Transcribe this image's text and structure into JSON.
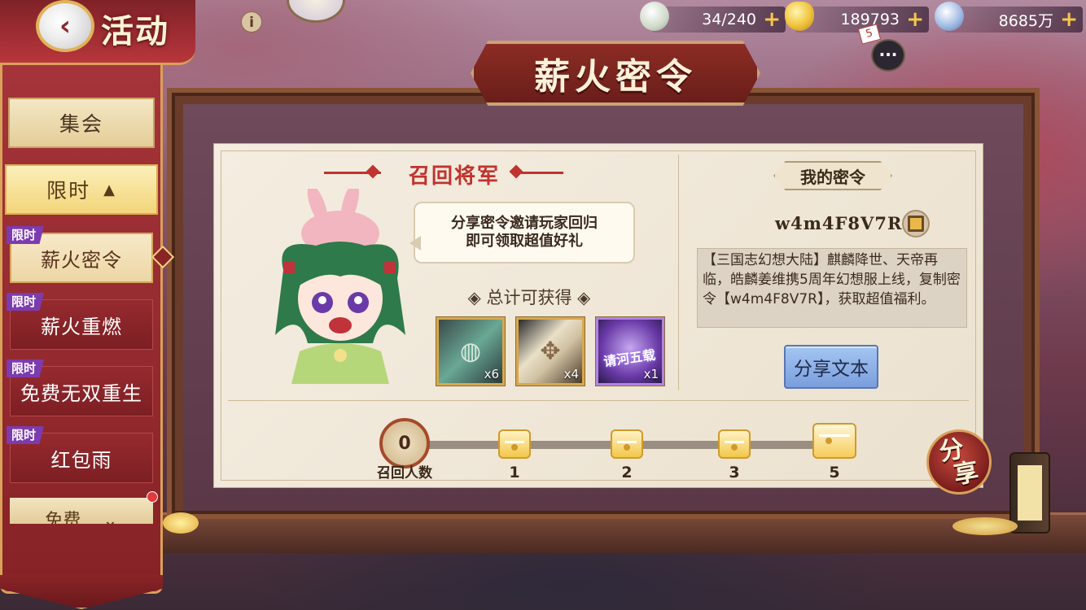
{
  "header": {
    "back_icon": "back-arrow-icon",
    "title": "活动",
    "info_label": "i"
  },
  "resources": [
    {
      "icon": "bun-icon",
      "value": "34/240"
    },
    {
      "icon": "gold-ingot-icon",
      "value": "189793"
    },
    {
      "icon": "silver-coin-icon",
      "value": "8685万"
    }
  ],
  "chat": {
    "badge": "5",
    "icon_label": "···"
  },
  "sidebar": {
    "gather_label": "集会",
    "limited_label": "限时",
    "limited_arrow": "▲",
    "tag_label": "限时",
    "items": [
      {
        "label": "薪火密令",
        "active": true
      },
      {
        "label": "薪火重燃",
        "active": false
      },
      {
        "label": "免费无双重生",
        "active": false
      },
      {
        "label": "红包雨",
        "active": false
      }
    ],
    "next_partial_label": "免费",
    "next_arrow": "⌄"
  },
  "board": {
    "title": "薪火密令",
    "left": {
      "section_title": "召回将军",
      "bubble_line1": "分享密令邀请玩家回归",
      "bubble_line2": "即可领取超值好礼",
      "total_label": "◈ 总计可获得 ◈",
      "rewards": [
        {
          "icon": "jade-card-icon",
          "qty": "x6"
        },
        {
          "icon": "scroll-map-icon",
          "qty": "x4"
        },
        {
          "icon": "skin-ticket-icon",
          "qty": "x1",
          "art_text": "请河五载"
        }
      ]
    },
    "right": {
      "my_code_label": "我的密令",
      "code": "w4m4F8V7R",
      "share_text": "【三国志幻想大陆】麒麟降世、天帝再临，皓麟姜维携5周年幻想服上线，复制密令【w4m4F8V7R】，获取超值福利。",
      "share_text_button": "分享文本"
    },
    "progress": {
      "count": "0",
      "count_label": "召回人数",
      "milestones": [
        "1",
        "2",
        "3",
        "5"
      ]
    }
  },
  "share_button": {
    "line1": "分",
    "line2": "享"
  }
}
